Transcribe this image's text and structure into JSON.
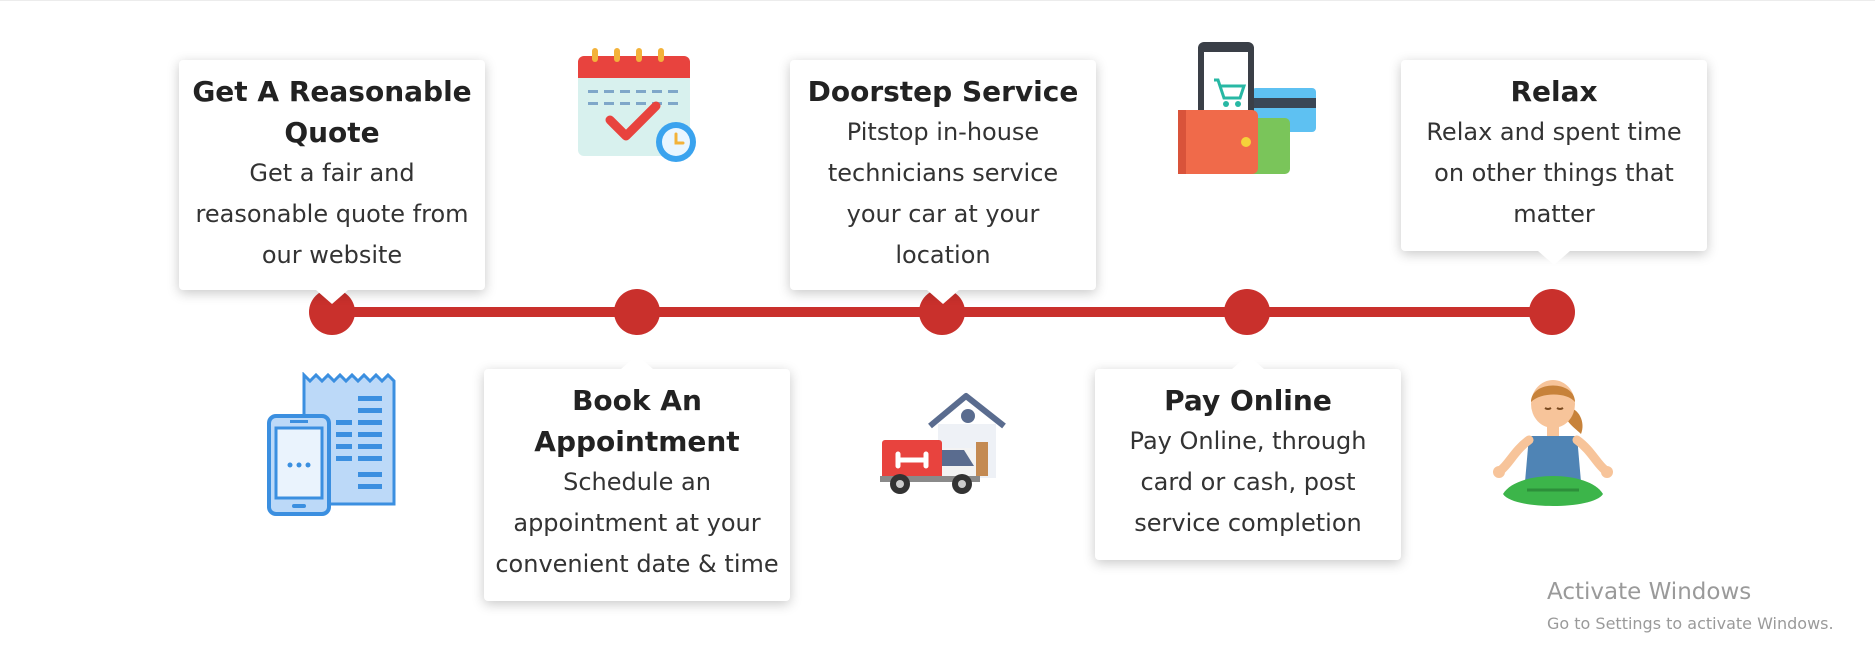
{
  "steps": [
    {
      "title": "Get A Reasonable Quote",
      "description": "Get a fair and reasonable quote from our website",
      "icon": "receipt-phone-icon"
    },
    {
      "title": "Book An Appointment",
      "description": "Schedule an appointment at your convenient date & time",
      "icon": "calendar-icon"
    },
    {
      "title": "Doorstep Service",
      "description": "Pitstop in-house technicians service your car at your location",
      "icon": "service-van-house-icon"
    },
    {
      "title": "Pay Online",
      "description": "Pay Online, through card or cash, post service completion",
      "icon": "wallet-card-icon"
    },
    {
      "title": "Relax",
      "description": "Relax and spent time on other things that matter",
      "icon": "meditation-icon"
    }
  ],
  "watermark": {
    "title": "Activate Windows",
    "subtitle": "Go to Settings to activate Windows."
  },
  "colors": {
    "accent": "#c9302c",
    "text": "#222222"
  }
}
